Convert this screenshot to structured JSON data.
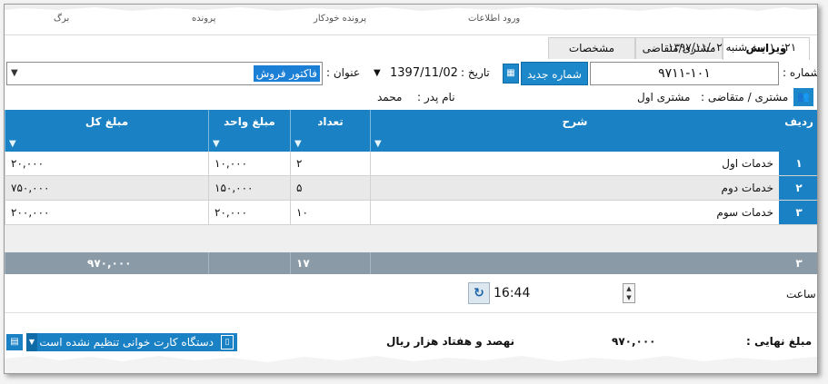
{
  "top_menu": [
    "برگ",
    "پرونده",
    "پرونده خودکار",
    "ورود اطلاعات"
  ],
  "tabs": [
    {
      "label": "ویرایش",
      "active": true
    },
    {
      "label": "مشتری/متقاضی",
      "active": false
    },
    {
      "label": "مشخصات",
      "active": false
    }
  ],
  "datetime": {
    "time": "۱۰:۲۱",
    "day": "سه شنبه",
    "date": "۱۳۹۷/۱۱/۰۲"
  },
  "form": {
    "number_label": "شماره :",
    "number_value": "۹۷۱۱-۱۰۱",
    "new_number_button": "شماره جدید",
    "date_label": "تاریخ :",
    "date_value": "1397/11/02",
    "title_label": "عنوان :",
    "title_value": "فاکتور فروش",
    "customer_label": "مشتری / متقاضی :",
    "customer_value": "مشتری اول",
    "father_label": "نام پدر :",
    "father_value": "محمد"
  },
  "grid": {
    "columns": [
      "ردیف",
      "شرح",
      "تعداد",
      "مبلغ واحد",
      "مبلغ کل"
    ],
    "rows": [
      {
        "idx": "۱",
        "desc": "خدمات اول",
        "qty": "۲",
        "unit": "۱۰,۰۰۰",
        "total": "۲۰,۰۰۰"
      },
      {
        "idx": "۲",
        "desc": "خدمات دوم",
        "qty": "۵",
        "unit": "۱۵۰,۰۰۰",
        "total": "۷۵۰,۰۰۰"
      },
      {
        "idx": "۳",
        "desc": "خدمات سوم",
        "qty": "۱۰",
        "unit": "۲۰,۰۰۰",
        "total": "۲۰۰,۰۰۰"
      }
    ],
    "summary": {
      "count": "۳",
      "qty": "۱۷",
      "total": "۹۷۰,۰۰۰"
    }
  },
  "time_row": {
    "label": "ساعت",
    "value": "16:44"
  },
  "footer": {
    "final_label": "مبلغ نهایی :",
    "final_value": "۹۷۰,۰۰۰",
    "amount_words": "نهصد و هفتاد  هزار  ریال",
    "card_reader": "دستگاه کارت خوانی تنظیم نشده است"
  },
  "colors": {
    "accent": "#1a82c4",
    "summary": "#8a9aa6",
    "selection": "#1c7fd6"
  },
  "icons": [
    "calendar-icon",
    "customers-icon",
    "refresh-icon",
    "filter-icon",
    "card-reader-icon",
    "calculator-icon"
  ]
}
